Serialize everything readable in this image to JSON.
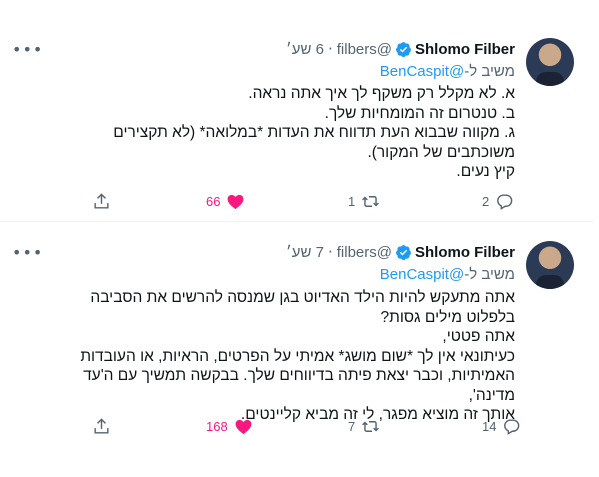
{
  "tweets": [
    {
      "author_name": "Shlomo Filber",
      "handle": "@filbers",
      "time": "6 שע׳",
      "reply_prefix": "משיב ל-",
      "reply_mention": "@BenCaspit",
      "lines": [
        "א. לא מקלל רק משקף לך איך אתה נראה.",
        "ב. טנטרום זה המומחיות שלך.",
        "ג. מקווה שבבוא העת תדווח את העדות *במלואה* (לא תקצירים",
        "משוכתבים של המקור).",
        "קיץ נעים."
      ],
      "replies": "2",
      "retweets": "1",
      "likes": "66"
    },
    {
      "author_name": "Shlomo Filber",
      "handle": "@filbers",
      "time": "7 שע׳",
      "reply_prefix": "משיב ל-",
      "reply_mention": "@BenCaspit",
      "lines": [
        "אתה מתעקש להיות הילד האדיוט בגן שמנסה להרשים את הסביבה",
        "בלפלוט מילים גסות?",
        "אתה פטטי,",
        "כעיתונאי אין לך *שום מושג* אמיתי על הפרטים, הראיות, או העובדות",
        "האמיתיות, וכבר יצאת פיתה בדיווחים שלך. בבקשה תמשיך עם ה'עד",
        "מדינה',",
        "אותך זה מוציא מפגר, לי זה מביא קליינטים."
      ],
      "replies": "14",
      "retweets": "7",
      "likes": "168"
    }
  ],
  "colors": {
    "accent": "#1d9bf0",
    "like": "#f91880",
    "muted": "#536471"
  },
  "icons": [
    "more-icon",
    "verified-icon",
    "reply-icon",
    "retweet-icon",
    "like-icon",
    "share-icon"
  ]
}
